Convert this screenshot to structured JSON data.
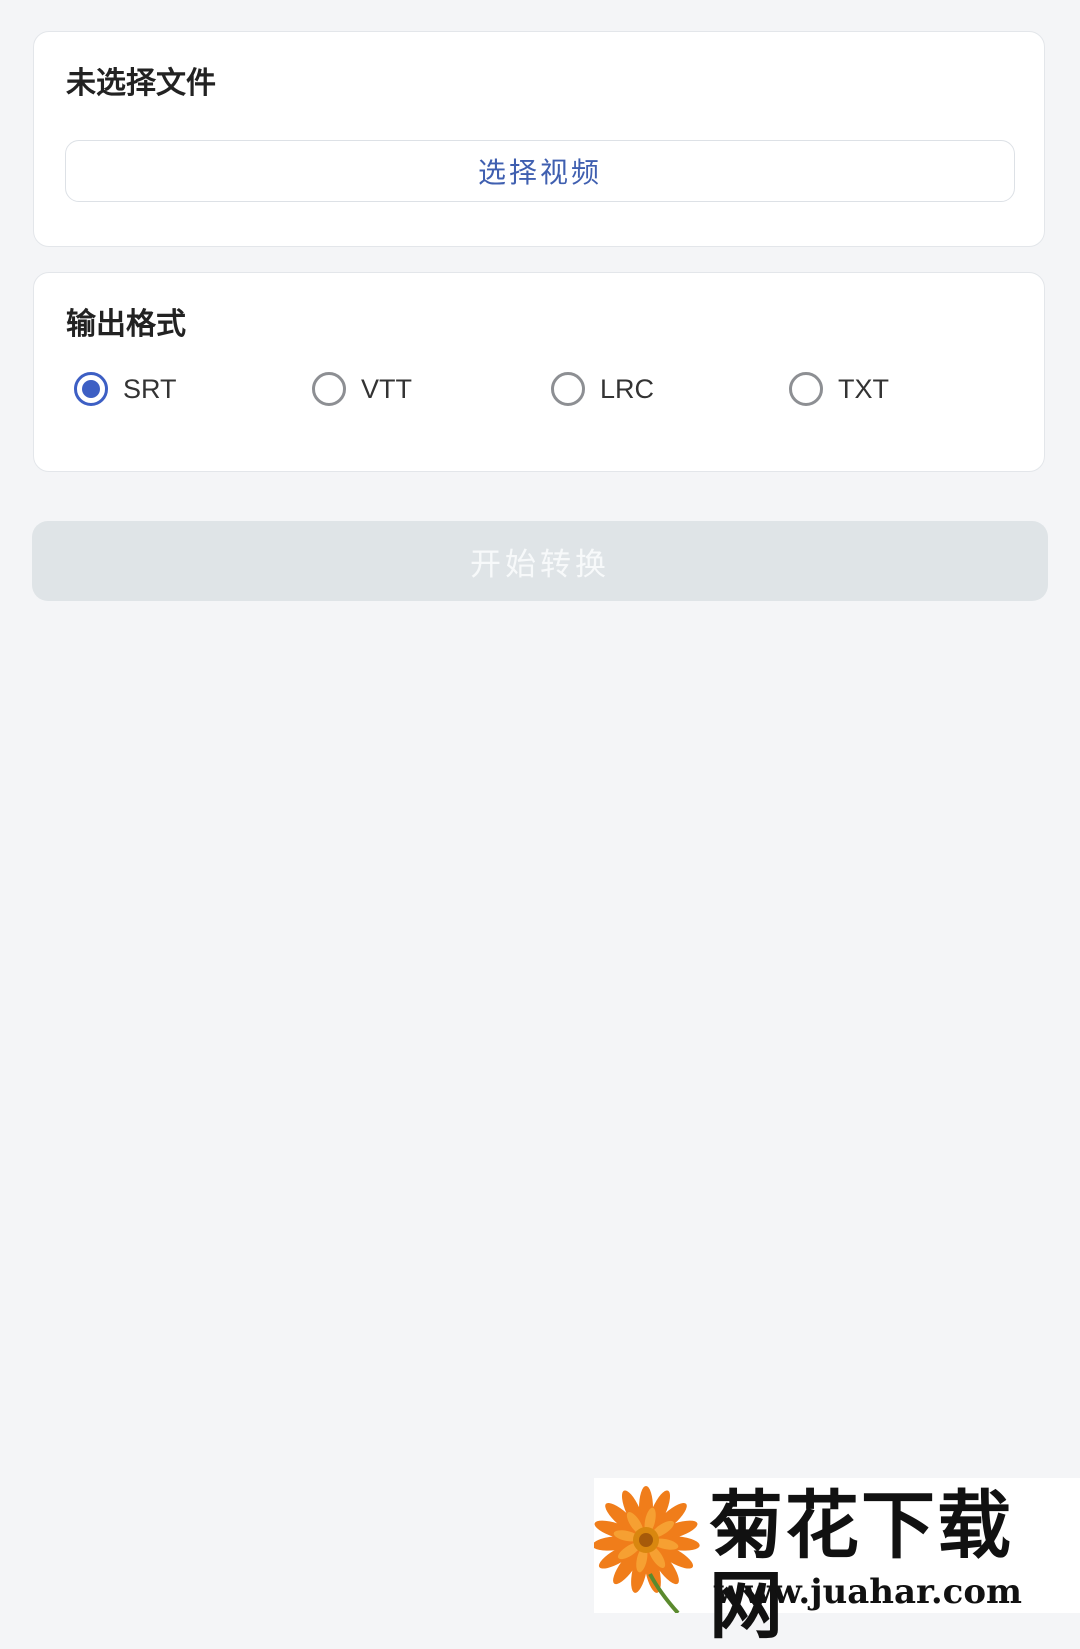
{
  "file_card": {
    "title": "未选择文件",
    "select_button_label": "选择视频"
  },
  "format_card": {
    "title": "输出格式",
    "options": [
      {
        "label": "SRT",
        "checked": true
      },
      {
        "label": "VTT",
        "checked": false
      },
      {
        "label": "LRC",
        "checked": false
      },
      {
        "label": "TXT",
        "checked": false
      }
    ]
  },
  "start_button_label": "开始转换",
  "watermark": {
    "title": "菊花下载网",
    "url": "www.juahar.com"
  },
  "colors": {
    "accent": "#3d5fc4",
    "button_text": "#3f5fb0",
    "disabled_button_bg": "#dfe4e7",
    "page_bg": "#f4f5f7"
  }
}
